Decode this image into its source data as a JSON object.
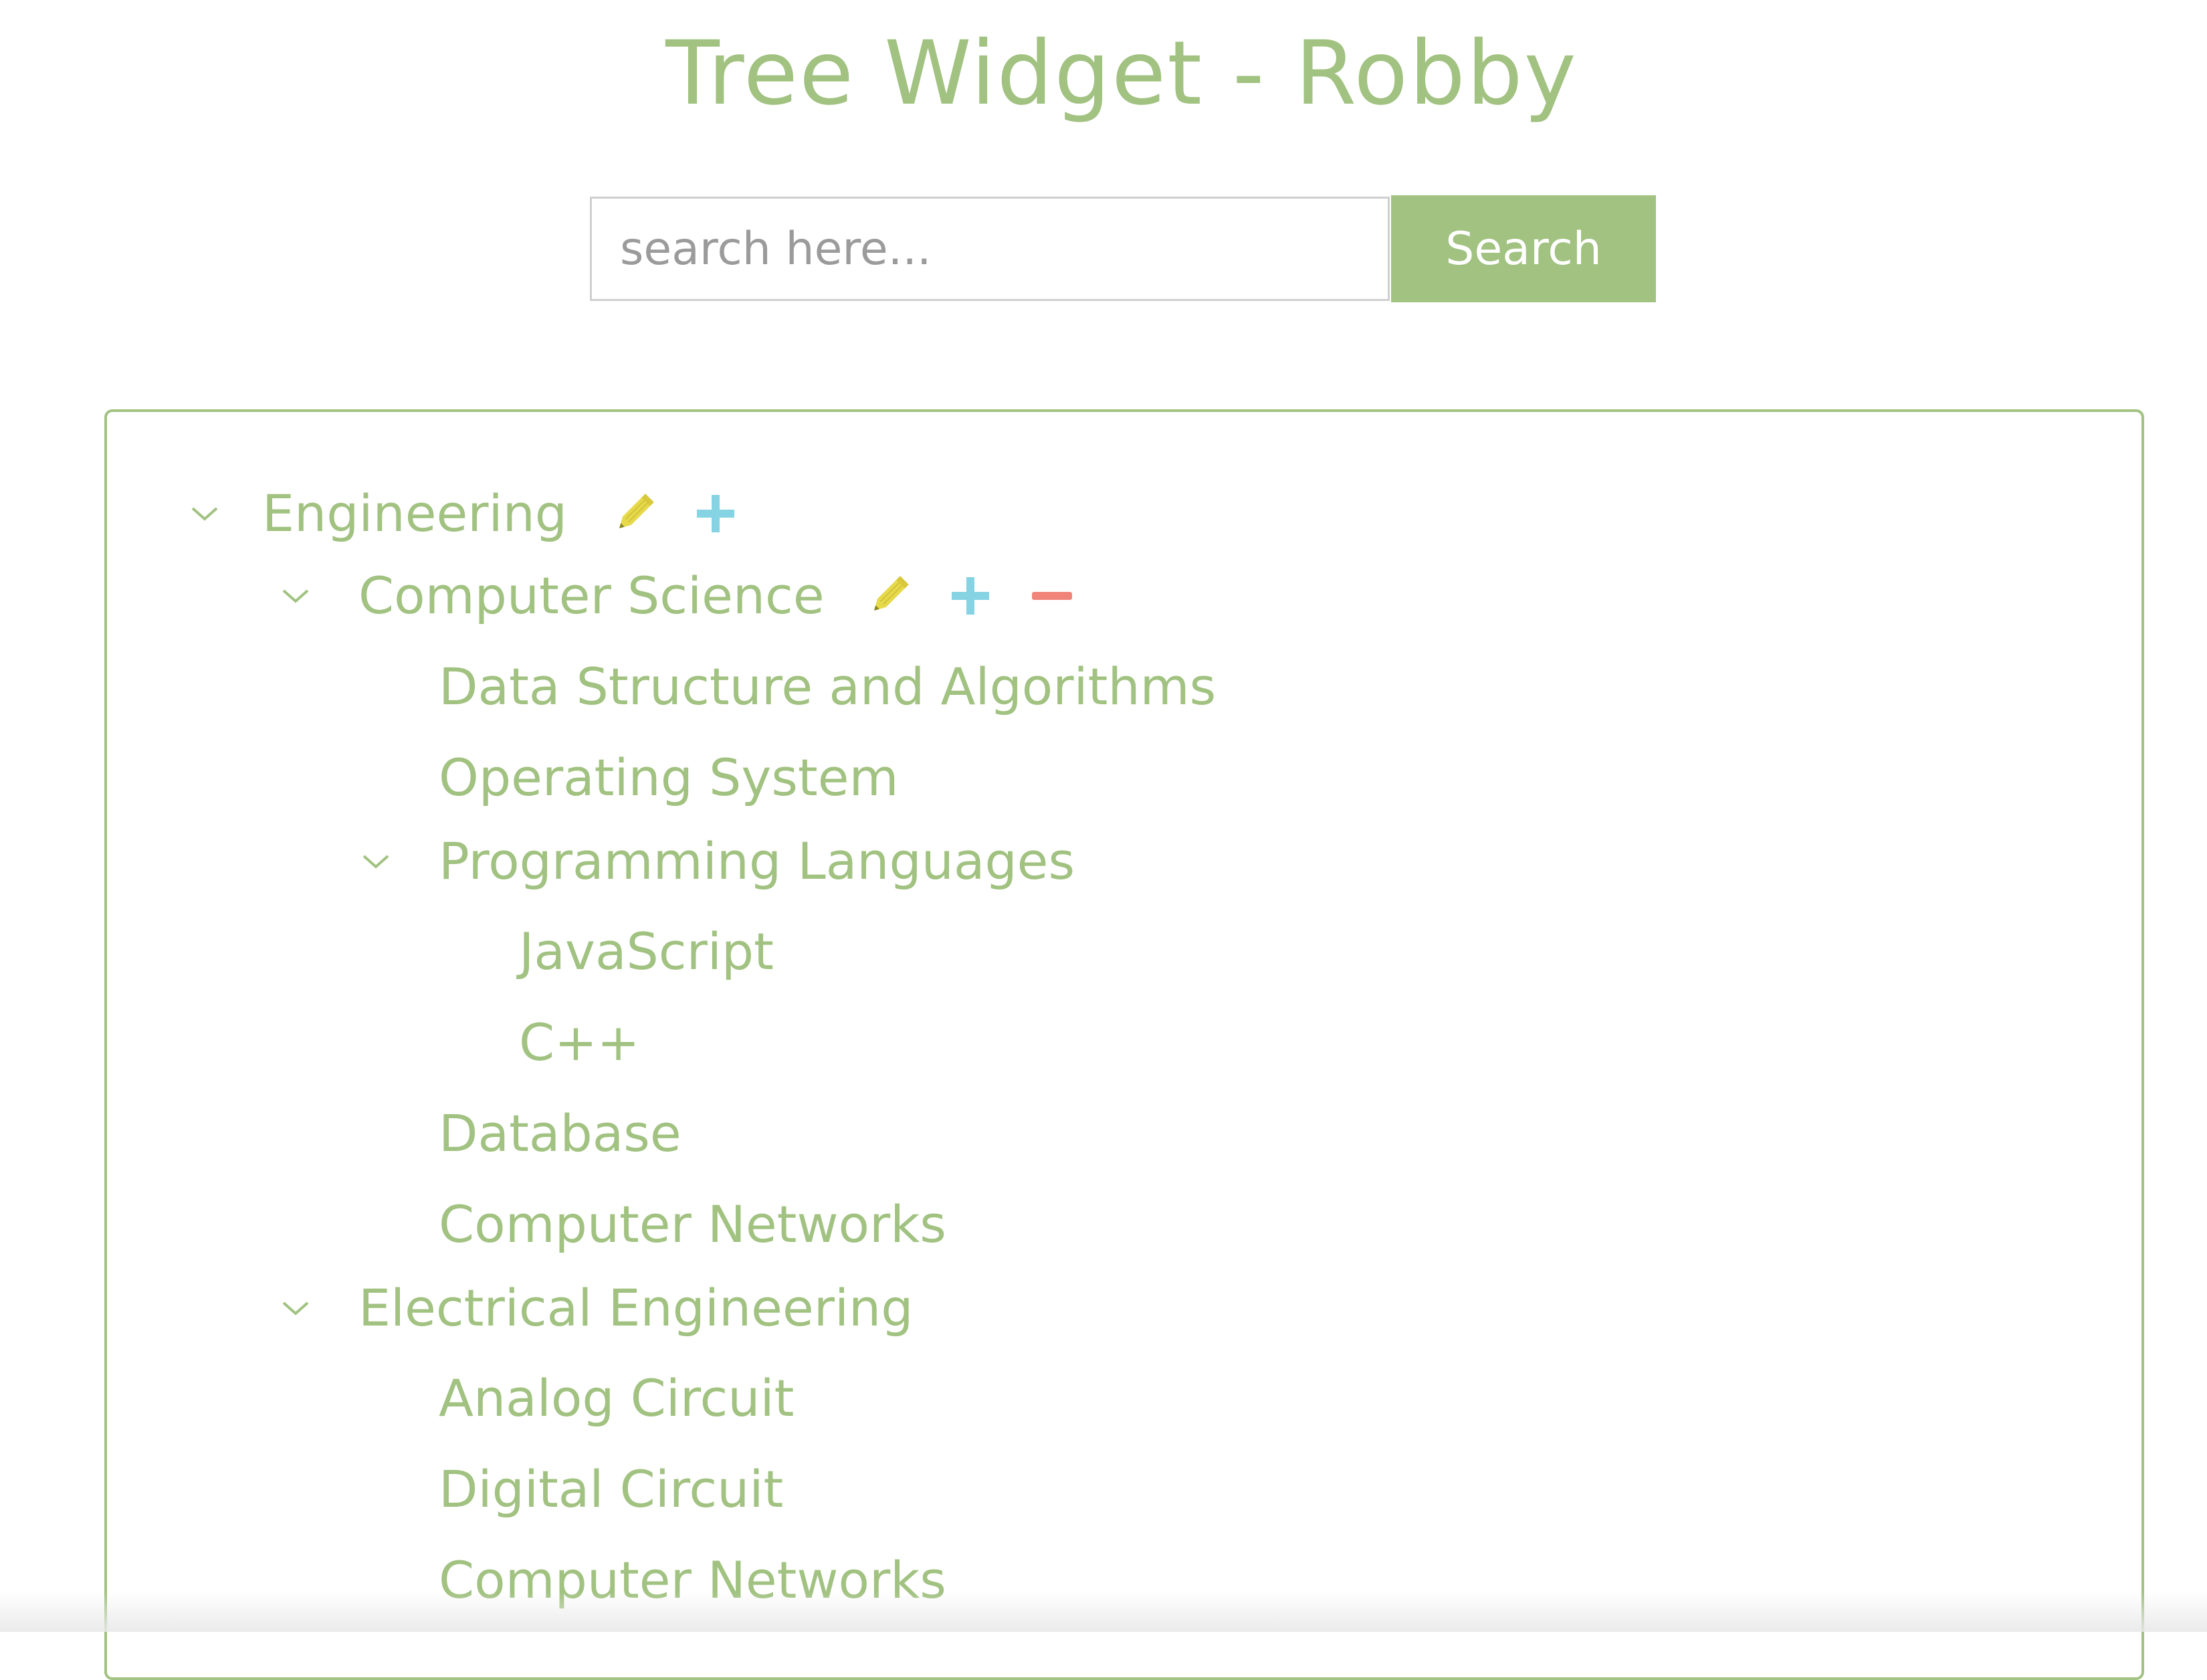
{
  "header": {
    "title": "Tree Widget - Robby"
  },
  "search": {
    "placeholder": "search here...",
    "value": "",
    "button_label": "Search"
  },
  "colors": {
    "accent": "#a1c281",
    "edit_icon": "#e6d94a",
    "add_icon": "#86d3e3",
    "remove_icon": "#f08479"
  },
  "tree": {
    "engineering": {
      "label": "Engineering",
      "expanded": true,
      "actions": [
        "pencil-icon",
        "plus-icon"
      ]
    },
    "computer_science": {
      "label": "Computer Science",
      "expanded": true,
      "actions": [
        "pencil-icon",
        "plus-icon",
        "minus-icon"
      ]
    },
    "dsa": {
      "label": "Data Structure and Algorithms"
    },
    "os": {
      "label": "Operating System"
    },
    "programming_languages": {
      "label": "Programming Languages",
      "expanded": true
    },
    "javascript": {
      "label": "JavaScript"
    },
    "cpp": {
      "label": "C++"
    },
    "database": {
      "label": "Database"
    },
    "cs_networks": {
      "label": "Computer Networks"
    },
    "electrical_engineering": {
      "label": "Electrical Engineering",
      "expanded": true
    },
    "analog_circuit": {
      "label": "Analog Circuit"
    },
    "digital_circuit": {
      "label": "Digital Circuit"
    },
    "ee_networks": {
      "label": "Computer Networks"
    }
  }
}
